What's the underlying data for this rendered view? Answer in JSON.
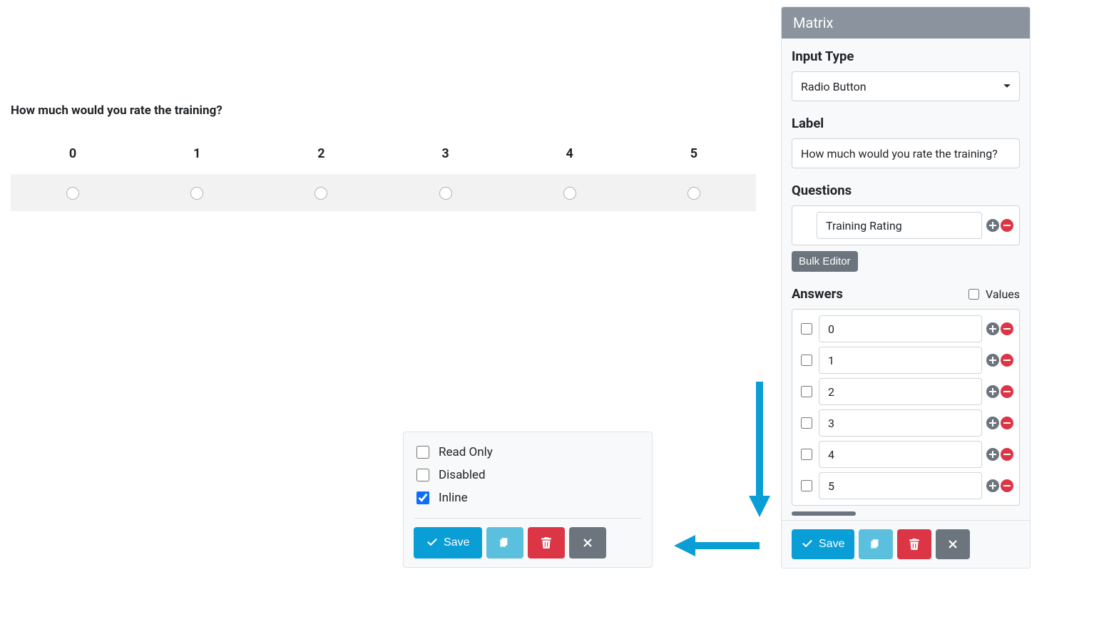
{
  "preview": {
    "label": "How much would you rate the training?",
    "headers": [
      "0",
      "1",
      "2",
      "3",
      "4",
      "5"
    ]
  },
  "panel": {
    "title": "Matrix",
    "input_type": {
      "label": "Input Type",
      "value": "Radio Button"
    },
    "label": {
      "label": "Label",
      "value": "How much would you rate the training?"
    },
    "questions": {
      "label": "Questions",
      "items": [
        "Training Rating"
      ],
      "bulk_editor": "Bulk Editor"
    },
    "answers": {
      "label": "Answers",
      "values_label": "Values",
      "items": [
        "0",
        "1",
        "2",
        "3",
        "4",
        "5"
      ]
    },
    "footer": {
      "save": "Save"
    }
  },
  "options_box": {
    "read_only": "Read Only",
    "disabled": "Disabled",
    "inline": "Inline",
    "save": "Save"
  }
}
